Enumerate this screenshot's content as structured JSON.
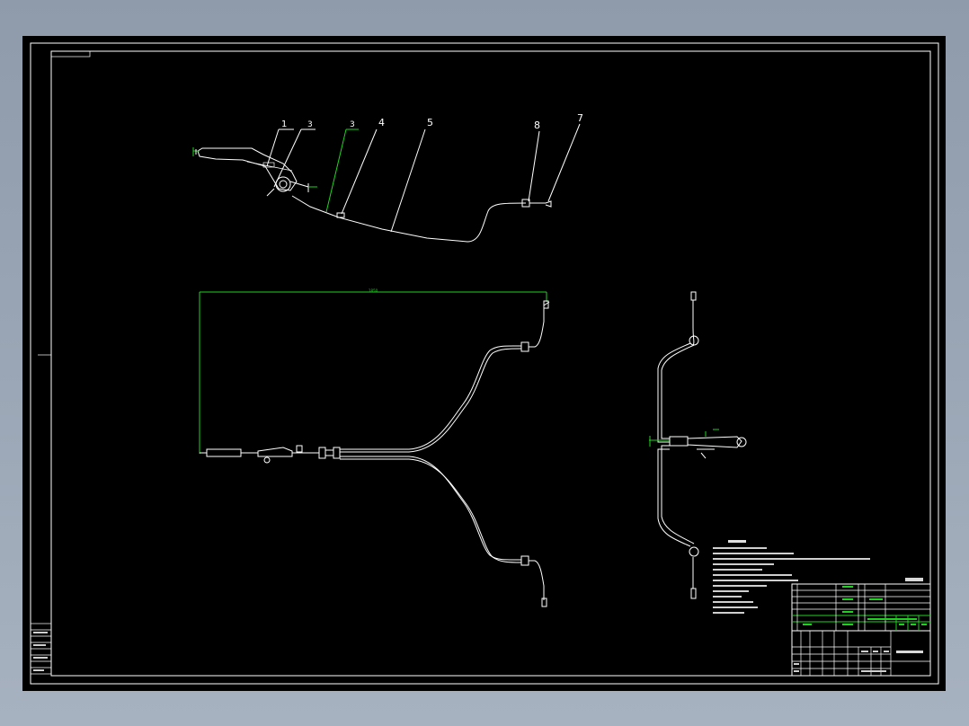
{
  "drawing": {
    "part_labels": [
      "1",
      "3",
      "3",
      "4",
      "5",
      "8",
      "7"
    ],
    "dimension_value": "1850",
    "colors": {
      "background": "#000000",
      "linework": "#ffffff",
      "dimension": "#1fd21f",
      "window_frame": "#9aa6b5"
    }
  }
}
